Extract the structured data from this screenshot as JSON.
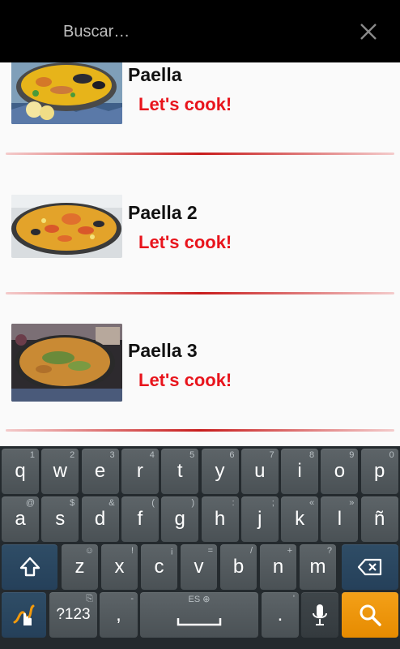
{
  "search": {
    "placeholder": "Buscar…"
  },
  "recipes": [
    {
      "title": "Paella",
      "action": "Let's cook!"
    },
    {
      "title": "Paella 2",
      "action": "Let's cook!"
    },
    {
      "title": "Paella 3",
      "action": "Let's cook!"
    }
  ],
  "keyboard": {
    "row1": [
      {
        "k": "q",
        "h": "1"
      },
      {
        "k": "w",
        "h": "2"
      },
      {
        "k": "e",
        "h": "3"
      },
      {
        "k": "r",
        "h": "4"
      },
      {
        "k": "t",
        "h": "5"
      },
      {
        "k": "y",
        "h": "6"
      },
      {
        "k": "u",
        "h": "7"
      },
      {
        "k": "i",
        "h": "8"
      },
      {
        "k": "o",
        "h": "9"
      },
      {
        "k": "p",
        "h": "0"
      }
    ],
    "row2": [
      {
        "k": "a",
        "h": "@"
      },
      {
        "k": "s",
        "h": "$"
      },
      {
        "k": "d",
        "h": "&"
      },
      {
        "k": "f",
        "h": "("
      },
      {
        "k": "g",
        "h": ")"
      },
      {
        "k": "h",
        "h": ":"
      },
      {
        "k": "j",
        "h": ";"
      },
      {
        "k": "k",
        "h": "«"
      },
      {
        "k": "l",
        "h": "»"
      },
      {
        "k": "ñ",
        "h": ""
      }
    ],
    "row3": [
      {
        "k": "z",
        "h": "☺"
      },
      {
        "k": "x",
        "h": "!"
      },
      {
        "k": "c",
        "h": "¡"
      },
      {
        "k": "v",
        "h": "="
      },
      {
        "k": "b",
        "h": "/"
      },
      {
        "k": "n",
        "h": "+"
      },
      {
        "k": "m",
        "h": "?"
      }
    ],
    "symbols_label": "?123",
    "comma": ",",
    "comma_hint": "-",
    "period": ".",
    "period_hint": "'",
    "lang_label": "ES"
  },
  "colors": {
    "accent": "#e8141c",
    "search_key": "#f39a0c",
    "divider": "#c81c1c"
  }
}
